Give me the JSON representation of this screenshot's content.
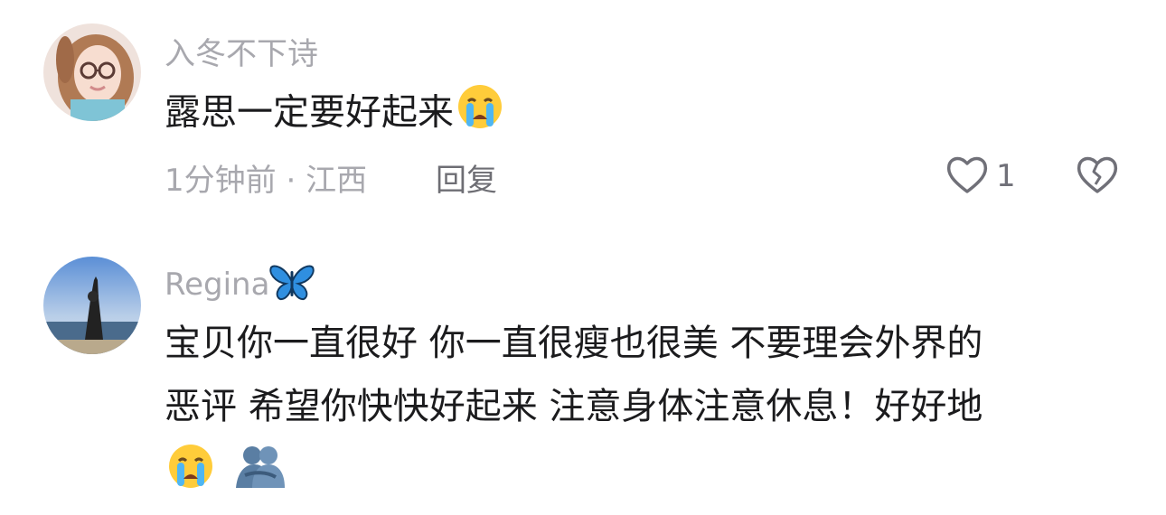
{
  "comments": [
    {
      "username": "入冬不下诗",
      "text": "露思一定要好起来",
      "time": "1分钟前",
      "location": "江西",
      "separator": "·",
      "reply_label": "回复",
      "like_count": "1",
      "avatar_icon": "avatar-girl-glasses",
      "emojis": [
        "crying-face-emoji"
      ]
    },
    {
      "username": "Regina",
      "username_badge": "butterfly-icon",
      "text_line1": "宝贝你一直很好 你一直很瘦也很美 不要理会外界的",
      "text_line2": "恶评 希望你快快好起来 注意身体注意休息！好好地",
      "avatar_icon": "avatar-beach-photo",
      "emojis": [
        "crying-face-emoji",
        "hug-emoji"
      ]
    }
  ],
  "colors": {
    "meta_gray": "#a8a8ae",
    "text_dark": "#1b1b1d",
    "reply_gray": "#6e6e74",
    "icon_gray": "#707078"
  }
}
